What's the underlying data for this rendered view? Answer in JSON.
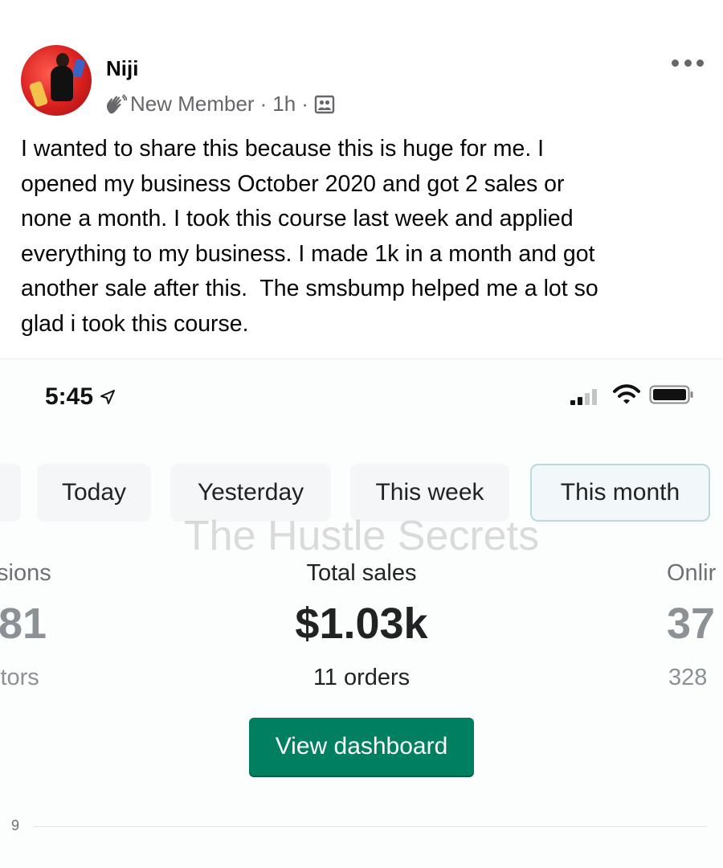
{
  "post": {
    "author": "Niji",
    "badge": "New Member",
    "time": "1h",
    "separator": "·",
    "text": "I wanted to share this because this is huge for me. I\nopened my business October 2020 and got 2 sales or\nnone a month. I took this course last week and applied\neverything to my business. I made 1k in a month and got\nanother sale after this.  The smsbump helped me a lot so\nglad i took this course.",
    "icons": {
      "badge": "wave-hand-icon",
      "privacy": "group-icon",
      "more": "more-options-icon"
    }
  },
  "screenshot": {
    "status_bar": {
      "time": "5:45",
      "icons": [
        "location-arrow-icon",
        "signal-icon",
        "wifi-icon",
        "battery-icon"
      ]
    },
    "tabs": [
      {
        "label": "Today",
        "selected": false
      },
      {
        "label": "Yesterday",
        "selected": false
      },
      {
        "label": "This week",
        "selected": false
      },
      {
        "label": "This month",
        "selected": true
      }
    ],
    "watermark": "The Hustle Secrets",
    "stats": {
      "left": {
        "label": "sions",
        "value": "81",
        "sub": "itors"
      },
      "center": {
        "label": "Total sales",
        "value": "$1.03k",
        "sub": "11 orders"
      },
      "right": {
        "label": "Onlir",
        "value": "37",
        "sub": "328"
      }
    },
    "dashboard_button": "View dashboard",
    "chart_tick": "9",
    "colors": {
      "accent": "#008060",
      "selected_tab_border": "#b9d9dc"
    }
  }
}
